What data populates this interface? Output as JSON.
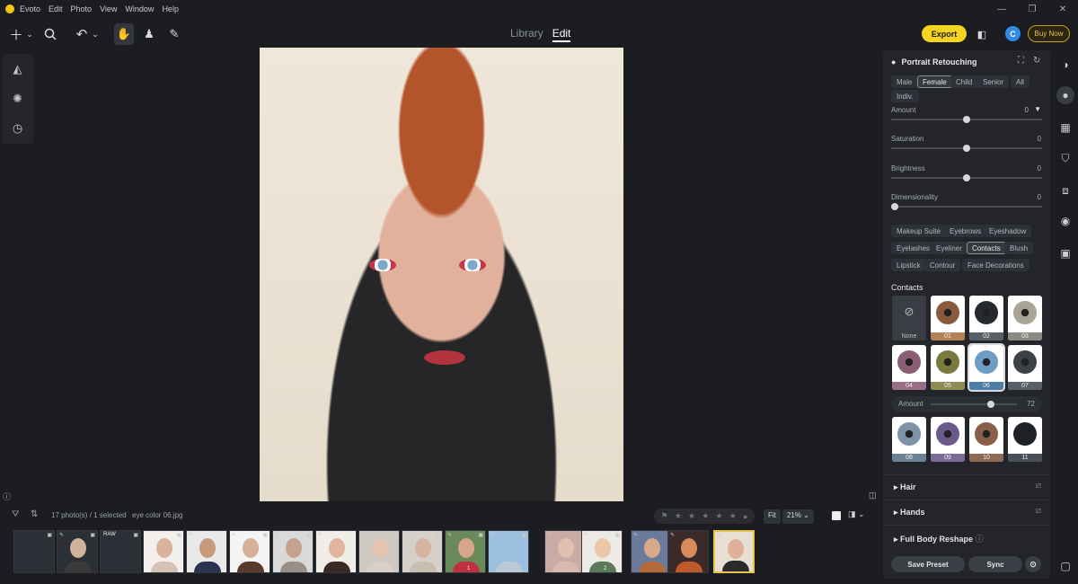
{
  "app": {
    "name": "Evoto",
    "menu": [
      "Edit",
      "Photo",
      "View",
      "Window",
      "Help"
    ],
    "window_controls": [
      "—",
      "❐",
      "✕"
    ]
  },
  "toolbar": {
    "modes": [
      "Library",
      "Edit"
    ],
    "active_mode": "Edit",
    "export_label": "Export",
    "avatar_letter": "C",
    "buy_label": "Buy Now",
    "icons": [
      "add-icon",
      "chevron-down-icon",
      "search-icon",
      "undo-icon",
      "hand-icon",
      "stamp-icon",
      "eraser-icon",
      "crop-compare-icon"
    ]
  },
  "left_tools": [
    "ai-edit-icon",
    "presets-icon",
    "history-icon"
  ],
  "panel": {
    "title": "Portrait Retouching",
    "subjects": [
      "Male",
      "Female",
      "Child",
      "Senior",
      "All",
      "Indiv."
    ],
    "active_subject": "Female",
    "sliders": [
      {
        "label": "Amount",
        "value": "0",
        "pos": 0.5
      },
      {
        "label": "Saturation",
        "value": "0",
        "pos": 0.5
      },
      {
        "label": "Brightness",
        "value": "0",
        "pos": 0.5
      },
      {
        "label": "Dimensionality",
        "value": "0",
        "pos": 0.0
      }
    ],
    "makeup_tabs": [
      "Makeup Suite",
      "Eyebrows",
      "Eyeshadow",
      "Eyelashes",
      "Eyeliner",
      "Contacts",
      "Blush",
      "Lipstick",
      "Contour",
      "Face Decorations"
    ],
    "active_makeup": "Contacts",
    "contacts_title": "Contacts",
    "none_label": "None",
    "lens_row1": [
      {
        "label": "01",
        "color": "#8a5a3c",
        "cap": "#b28156"
      },
      {
        "label": "02",
        "color": "#26292e",
        "cap": "#5a5e66"
      },
      {
        "label": "03",
        "color": "#a9a593",
        "cap": "#8c8a80"
      }
    ],
    "lens_row2": [
      {
        "label": "04",
        "color": "#8a5f75",
        "cap": "#9a6f86"
      },
      {
        "label": "05",
        "color": "#7a7a3e",
        "cap": "#8d8c52"
      },
      {
        "label": "06",
        "color": "#6b9dc7",
        "cap": "#4b7fa8"
      },
      {
        "label": "07",
        "color": "#3d4249",
        "cap": "#5a5e66"
      }
    ],
    "contacts_amount": {
      "label": "Amount",
      "value": "72",
      "pos": 0.72
    },
    "lens_row3": [
      {
        "label": "08",
        "color": "#7e92a8",
        "cap": "#6b8196"
      },
      {
        "label": "09",
        "color": "#6a5a8a",
        "cap": "#7b6c96"
      },
      {
        "label": "10",
        "color": "#8a5f4a",
        "cap": "#8e6a55"
      },
      {
        "label": "11",
        "color": "#1e2126",
        "cap": "#4a4e56"
      }
    ],
    "collapsed": [
      "Hair",
      "Hands",
      "Full Body Reshape"
    ],
    "save_preset": "Save Preset",
    "sync": "Sync"
  },
  "right_strip": [
    "palette-icon",
    "portrait-icon",
    "adjust-icon",
    "clothing-icon",
    "crop-icon",
    "camera-icon",
    "folder-icon"
  ],
  "filmstrip": {
    "count_text": "17 photo(s) / 1 selected",
    "filename": "eye color 06.jpg",
    "fit_label": "Fit",
    "zoom": "21%",
    "raw_label": "RAW",
    "count_badge_1": "1",
    "count_badge_2": "2"
  }
}
